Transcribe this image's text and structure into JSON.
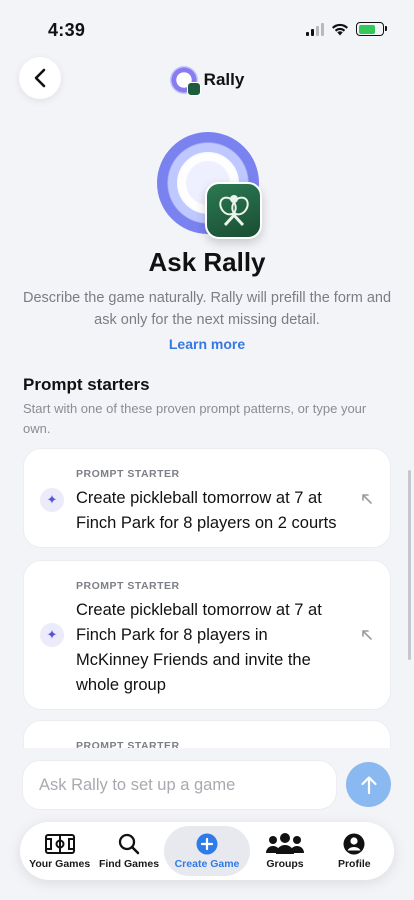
{
  "status_bar": {
    "time": "4:39"
  },
  "header": {
    "title": "Rally"
  },
  "hero": {
    "title": "Ask Rally",
    "description": "Describe the game naturally. Rally will prefill the form and ask only for the next missing detail.",
    "learn_more": "Learn more"
  },
  "prompt_starters": {
    "title": "Prompt starters",
    "description": "Start with one of these proven prompt patterns, or type your own.",
    "items": [
      {
        "eyebrow": "PROMPT STARTER",
        "text": "Create pickleball tomorrow at 7 at Finch Park for 8 players on 2 courts"
      },
      {
        "eyebrow": "PROMPT STARTER",
        "text": "Create pickleball tomorrow at 7 at Finch Park for 8 players in McKinney Friends and invite the whole group"
      },
      {
        "eyebrow": "PROMPT STARTER",
        "text": ""
      }
    ]
  },
  "composer": {
    "placeholder": "Ask Rally to set up a game",
    "value": ""
  },
  "tab_bar": {
    "tabs": [
      {
        "label": "Your Games",
        "icon": "court-icon"
      },
      {
        "label": "Find Games",
        "icon": "search-icon"
      },
      {
        "label": "Create Game",
        "icon": "plus-circle-icon",
        "active": true
      },
      {
        "label": "Groups",
        "icon": "people-icon"
      },
      {
        "label": "Profile",
        "icon": "person-icon"
      }
    ]
  },
  "colors": {
    "accent": "#2f7be8",
    "send_button": "#8ab8f0",
    "badge_green": "#1e5c3e"
  }
}
